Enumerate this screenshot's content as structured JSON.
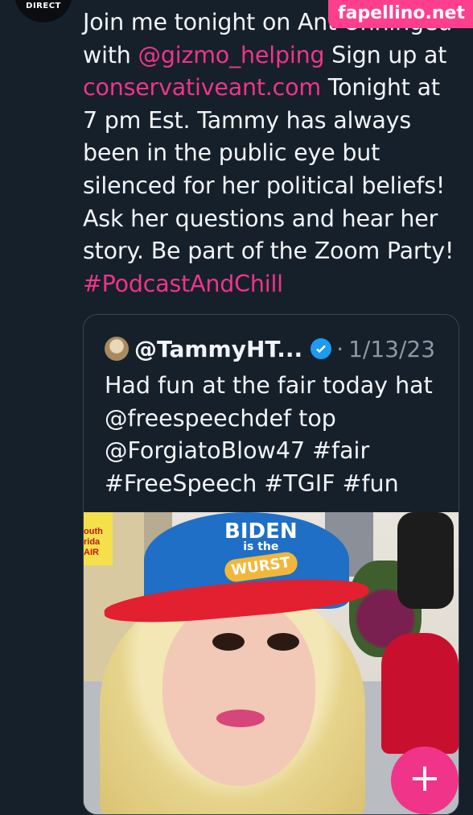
{
  "watermark": "fapellino.net",
  "author": {
    "shirt_text": "DIRECT"
  },
  "tweet": {
    "lines": [
      {
        "parts": [
          {
            "t": "Join me tonight on Ant Unhinged"
          }
        ]
      },
      {
        "parts": [
          {
            "t": "with "
          },
          {
            "t": "@gizmo_helping",
            "link": true
          },
          {
            "t": " Sign up at"
          }
        ]
      },
      {
        "parts": [
          {
            "t": "conservativeant.com",
            "link": true
          },
          {
            "t": " Tonight at"
          }
        ]
      },
      {
        "parts": [
          {
            "t": "7 pm Est. Tammy has always"
          }
        ]
      },
      {
        "parts": [
          {
            "t": "been in the public eye but"
          }
        ]
      },
      {
        "parts": [
          {
            "t": "silenced for her political beliefs!"
          }
        ]
      },
      {
        "parts": [
          {
            "t": "Ask her questions and hear her"
          }
        ]
      },
      {
        "parts": [
          {
            "t": "story. Be part of the Zoom Party!"
          }
        ]
      },
      {
        "parts": [
          {
            "t": "#PodcastAndChill",
            "link": true
          }
        ]
      }
    ]
  },
  "quoted": {
    "handle": "@TammyHT...",
    "separator": "·",
    "date": "1/13/23",
    "text": "Had fun at the fair today hat\n@freespeechdef top\n@ForgiatoBlow47 #fair\n#FreeSpeech #TGIF #fun",
    "photo": {
      "cap_line1": "BIDEN",
      "cap_line2": "is the",
      "cap_line3": "WURST",
      "sign_text": "outh\nrida\nAIR"
    }
  },
  "fab": {
    "label": "+"
  },
  "colors": {
    "background": "#15202b",
    "accent": "#f0348a",
    "verified": "#1d9bf0"
  }
}
